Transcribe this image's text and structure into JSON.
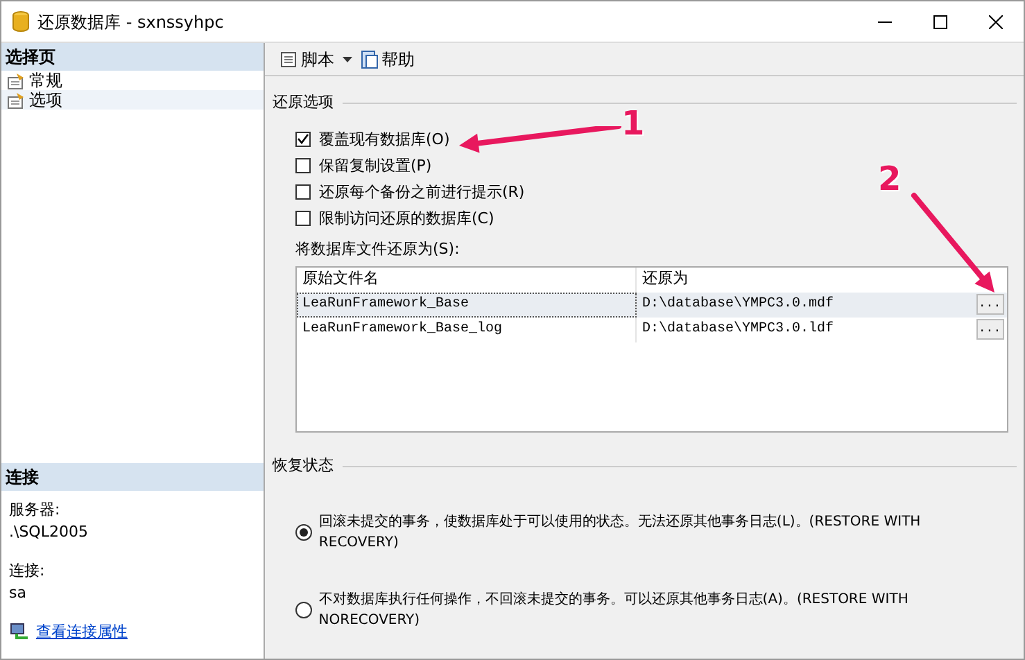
{
  "window": {
    "title": "还原数据库 - sxnssyhpc"
  },
  "sidebar": {
    "header": "选择页",
    "items": [
      {
        "label": "常规",
        "selected": false
      },
      {
        "label": "选项",
        "selected": true
      }
    ]
  },
  "connection": {
    "header": "连接",
    "server_label": "服务器:",
    "server": ".\\SQL2005",
    "login_label": "连接:",
    "login": "sa",
    "link": "查看连接属性"
  },
  "toolbar": [
    {
      "label": "脚本",
      "kind": "script"
    },
    {
      "label": "帮助",
      "kind": "help"
    }
  ],
  "restore_options": {
    "title": "还原选项",
    "checkboxes": [
      {
        "label": "覆盖现有数据库(O)",
        "checked": true
      },
      {
        "label": "保留复制设置(P)",
        "checked": false
      },
      {
        "label": "还原每个备份之前进行提示(R)",
        "checked": false
      },
      {
        "label": "限制访问还原的数据库(C)",
        "checked": false
      }
    ],
    "files_label": "将数据库文件还原为(S):",
    "table": {
      "columns": [
        "原始文件名",
        "还原为"
      ],
      "rows": [
        {
          "original": "LeaRunFramework_Base",
          "restore_as": "D:\\database\\YMPC3.0.mdf",
          "button": "...",
          "selected": true
        },
        {
          "original": "LeaRunFramework_Base_log",
          "restore_as": "D:\\database\\YMPC3.0.ldf",
          "button": "...",
          "selected": false
        }
      ]
    }
  },
  "recovery_state": {
    "title": "恢复状态",
    "options": [
      {
        "label": "回滚未提交的事务，使数据库处于可以使用的状态。无法还原其他事务日志(L)。(RESTORE WITH RECOVERY)",
        "selected": true
      },
      {
        "label": "不对数据库执行任何操作，不回滚未提交的事务。可以还原其他事务日志(A)。(RESTORE WITH NORECOVERY)",
        "selected": false
      }
    ]
  },
  "annotations": [
    {
      "label": "1"
    },
    {
      "label": "2"
    }
  ]
}
